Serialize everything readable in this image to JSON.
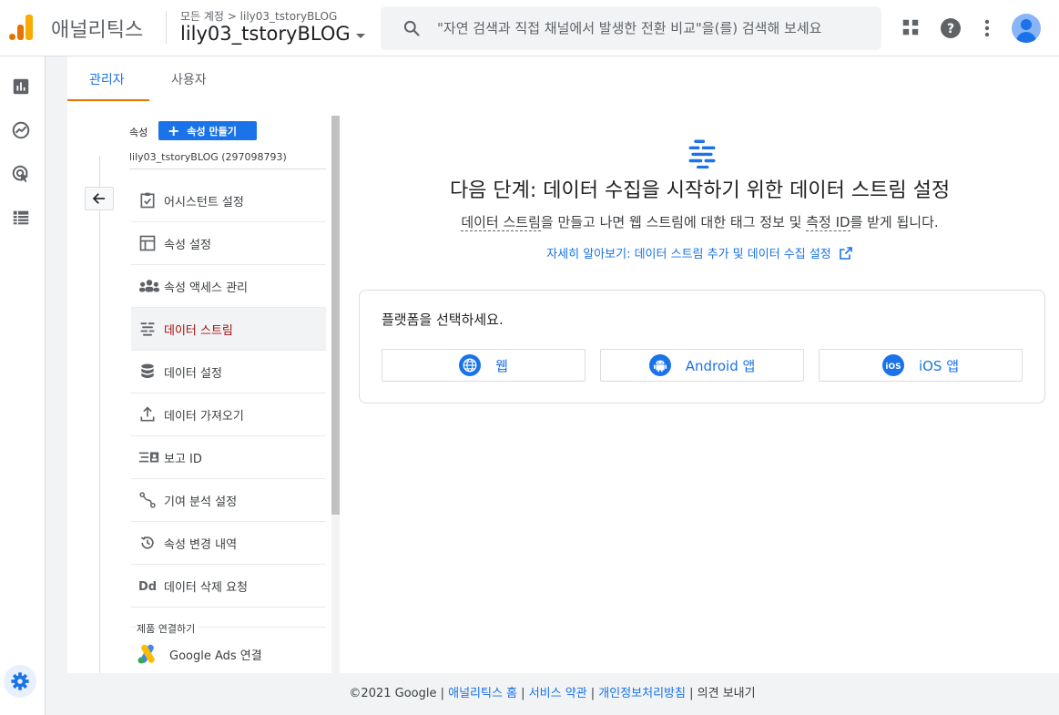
{
  "header": {
    "app_name": "애널리틱스",
    "breadcrumb": "모든 계정 > lily03_tstoryBLOG",
    "account_name": "lily03_tstoryBLOG",
    "search_placeholder": "\"자연 검색과 직접 채널에서 발생한 전환 비교\"을(를) 검색해 보세요"
  },
  "rail": {
    "items": [
      "bar-chart-icon",
      "explore-icon",
      "advertising-icon",
      "table-icon"
    ],
    "settings": "gear-icon"
  },
  "tabs": [
    {
      "label": "관리자",
      "active": true
    },
    {
      "label": "사용자",
      "active": false
    }
  ],
  "property": {
    "section_label": "속성",
    "create_button": "속성 만들기",
    "name": "lily03_tstoryBLOG (297098793)"
  },
  "menu": [
    {
      "label": "어시스턴트 설정",
      "icon": "checklist-icon"
    },
    {
      "label": "속성 설정",
      "icon": "layout-icon"
    },
    {
      "label": "속성 액세스 관리",
      "icon": "people-icon"
    },
    {
      "label": "데이터 스트림",
      "icon": "streams-icon",
      "active": true
    },
    {
      "label": "데이터 설정",
      "icon": "database-icon"
    },
    {
      "label": "데이터 가져오기",
      "icon": "upload-icon"
    },
    {
      "label": "보고 ID",
      "icon": "reporting-id-icon"
    },
    {
      "label": "기여 분석 설정",
      "icon": "attribution-icon"
    },
    {
      "label": "속성 변경 내역",
      "icon": "history-icon"
    },
    {
      "label": "데이터 삭제 요청",
      "icon": "dd-icon"
    }
  ],
  "product_links": {
    "label": "제품 연결하기",
    "google_ads": "Google Ads 연결"
  },
  "main": {
    "title": "다음 단계: 데이터 수집을 시작하기 위한 데이터 스트림 설정",
    "desc_part1": "데이터 스트림",
    "desc_part2": "을 만들고 나면 웹 스트림에 대한 태그 정보 및 ",
    "desc_part3": "측정 ID",
    "desc_part4": "를 받게 됩니다.",
    "link": "자세히 알아보기: 데이터 스트림 추가 및 데이터 수집 설정",
    "platform_prompt": "플랫폼을 선택하세요.",
    "platforms": [
      "웹",
      "Android 앱",
      "iOS 앱"
    ]
  },
  "footer": {
    "copyright": "©2021 Google",
    "links": [
      "애널리틱스 홈",
      "서비스 약관",
      "개인정보처리방침"
    ],
    "feedback": "의견 보내기"
  },
  "colors": {
    "accent": "#1a73e8",
    "active_tab_ink": "#e37400",
    "active_menu_text": "#a50e0e"
  }
}
